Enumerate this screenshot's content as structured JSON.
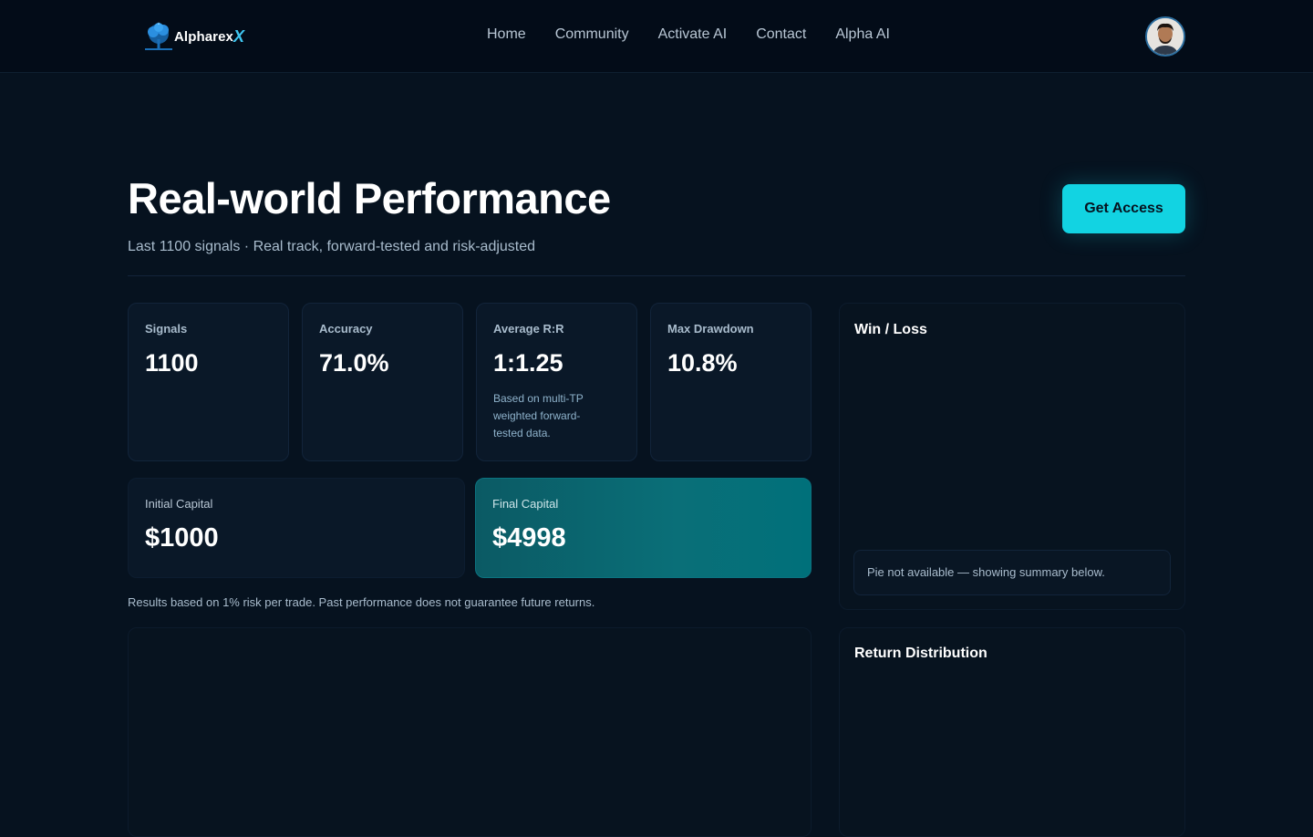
{
  "brand": {
    "name": "Alpharex",
    "x_mark": "X"
  },
  "nav": {
    "items": [
      {
        "label": "Home"
      },
      {
        "label": "Community"
      },
      {
        "label": "Activate AI"
      },
      {
        "label": "Contact"
      },
      {
        "label": "Alpha AI"
      }
    ]
  },
  "hero": {
    "title": "Real-world Performance",
    "subtitle": "Last 1100 signals · Real track, forward-tested and risk-adjusted",
    "cta_label": "Get Access"
  },
  "stats": [
    {
      "label": "Signals",
      "value": "1100"
    },
    {
      "label": "Accuracy",
      "value": "71.0%"
    },
    {
      "label": "Average R:R",
      "value": "1:1.25",
      "note": "Based on multi-TP weighted forward-tested data."
    },
    {
      "label": "Max Drawdown",
      "value": "10.8%"
    }
  ],
  "capital": {
    "initial": {
      "label": "Initial Capital",
      "value": "$1000"
    },
    "final": {
      "label": "Final Capital",
      "value": "$4998"
    }
  },
  "disclaimer": "Results based on 1% risk per trade. Past performance does not guarantee future returns.",
  "win_loss": {
    "title": "Win / Loss",
    "fallback": "Pie not available — showing summary below."
  },
  "return_distribution": {
    "title": "Return Distribution"
  },
  "colors": {
    "accent": "#12d3e2",
    "background": "#06121f",
    "final_capital": "#0a6f78"
  },
  "icons": {
    "logo": "tree-logo-icon",
    "avatar": "user-avatar"
  }
}
